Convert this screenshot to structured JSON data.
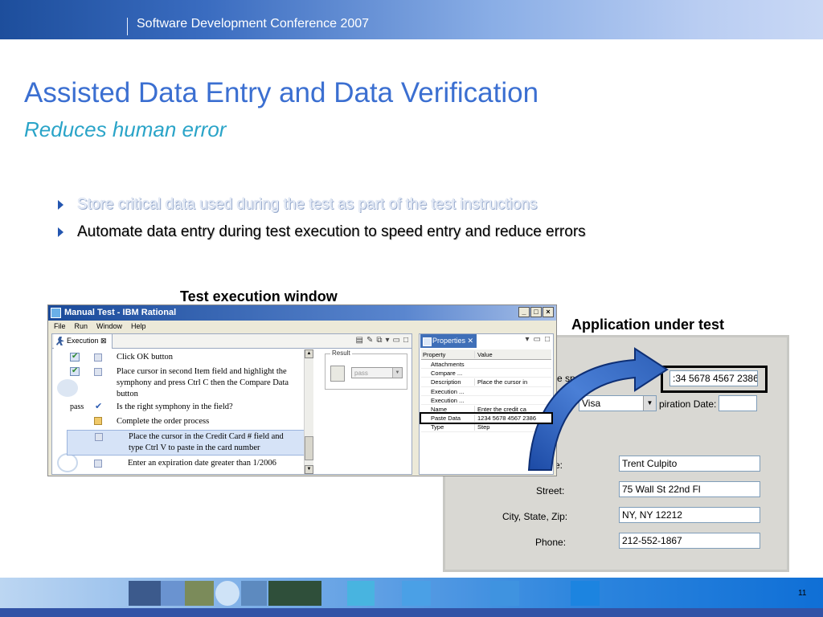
{
  "header": {
    "conference": "Software Development Conference 2007"
  },
  "slide": {
    "title": "Assisted Data Entry and Data Verification",
    "subtitle": "Reduces human error",
    "bullets": [
      "Store critical data used during the test as part of the test instructions",
      "Automate data entry during test execution to speed entry and reduce errors"
    ],
    "captions": {
      "execution_window": "Test execution window",
      "application": "Application under test"
    },
    "page_number": "11"
  },
  "exec_window": {
    "title": "Manual Test - IBM Rational",
    "controls": [
      "_",
      "□",
      "×"
    ],
    "menu": [
      "File",
      "Run",
      "Window",
      "Help"
    ],
    "execution_tab": "Execution",
    "steps": [
      {
        "text": "Click OK button"
      },
      {
        "text": "Place cursor in second Item field and highlight the symphony and press Ctrl C then the Compare Data button"
      },
      {
        "text": "Is the right symphony in the field?",
        "result": "pass"
      },
      {
        "text": "Complete the order process"
      },
      {
        "text": "Place the cursor in the Credit Card # field and type Ctrl V to paste in the card number"
      },
      {
        "text": "Enter an expiration date greater than 1/2006"
      }
    ],
    "result_group": {
      "legend": "Result",
      "value": "pass"
    },
    "properties_tab": "Properties",
    "properties": {
      "headers": [
        "Property",
        "Value"
      ],
      "rows": [
        {
          "property": "Attachments",
          "value": ""
        },
        {
          "property": "Compare ...",
          "value": ""
        },
        {
          "property": "Description",
          "value": "Place the cursor in"
        },
        {
          "property": "Execution ...",
          "value": ""
        },
        {
          "property": "Execution ...",
          "value": ""
        },
        {
          "property": "Name",
          "value": "Enter the credit ca"
        },
        {
          "property": "Paste Data",
          "value": "1234 5678 4567 2386"
        },
        {
          "property": "Type",
          "value": "Step"
        }
      ]
    }
  },
  "app_under_test": {
    "card_label": "e spaces):",
    "card_value": ":34 5678 4567 2386",
    "card_type": "Visa",
    "expiration_label": "piration Date:",
    "expiration_value": "",
    "name_label": "e:",
    "name_value": "Trent Culpito",
    "street_label": "Street:",
    "street_value": "75 Wall St 22nd Fl",
    "city_label": "City, State, Zip:",
    "city_value": "NY, NY 12212",
    "phone_label": "Phone:",
    "phone_value": "212-552-1867"
  },
  "colors": {
    "title": "#3b6fd1",
    "subtitle": "#2aa4c8",
    "band": "#2e86de",
    "arrow": "#2d5fb7"
  }
}
